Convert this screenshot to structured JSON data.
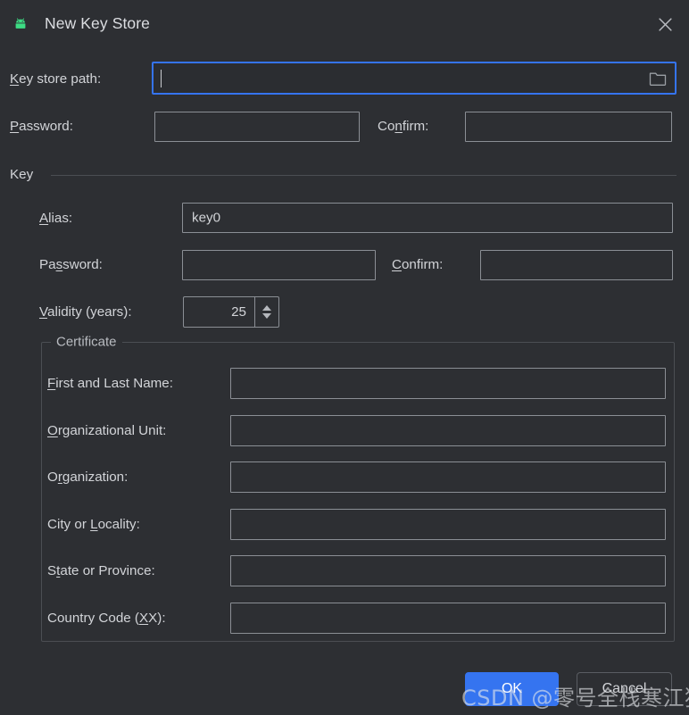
{
  "window": {
    "title": "New Key Store",
    "app_icon": "android-icon",
    "close_icon": "close-icon",
    "background_color": "#2d2f33",
    "accent_color": "#3574f0"
  },
  "keystore": {
    "path_label_pre": "K",
    "path_label_post": "ey store path:",
    "path_value": "",
    "browse_icon": "folder-icon",
    "password_label_pre": "P",
    "password_label_post": "assword:",
    "password_value": "",
    "confirm_label_pre": "Co",
    "confirm_label_mn": "n",
    "confirm_label_post": "firm:",
    "confirm_value": ""
  },
  "key_section": {
    "title": "Key",
    "alias_label_pre": "A",
    "alias_label_post": "lias:",
    "alias_value": "key0",
    "password_label_pre": "Pa",
    "password_label_mn": "s",
    "password_label_post": "sword:",
    "password_value": "",
    "confirm_label_pre": "C",
    "confirm_label_post": "onfirm:",
    "confirm_value": "",
    "validity_label_pre": "V",
    "validity_label_post": "alidity (years):",
    "validity_value": "25",
    "spinner_up_icon": "chevron-up-icon",
    "spinner_down_icon": "chevron-down-icon"
  },
  "certificate": {
    "legend": "Certificate",
    "fields": [
      {
        "pre": "F",
        "mn": "",
        "post": "irst and Last Name:",
        "value": "",
        "name": "first-and-last-name"
      },
      {
        "pre": "O",
        "mn": "",
        "post": "rganizational Unit:",
        "value": "",
        "name": "organizational-unit"
      },
      {
        "pre": "O",
        "mn": "r",
        "post": "ganization:",
        "value": "",
        "name": "organization"
      },
      {
        "pre": "City or ",
        "mn": "L",
        "post": "ocality:",
        "value": "",
        "name": "city-or-locality"
      },
      {
        "pre": "S",
        "mn": "t",
        "post": "ate or Province:",
        "value": "",
        "name": "state-or-province"
      },
      {
        "pre": "Country Code (",
        "mn": "X",
        "post": "X):",
        "value": "",
        "name": "country-code"
      }
    ]
  },
  "footer": {
    "ok_label": "OK",
    "cancel_label": "Cancel"
  },
  "watermark": {
    "text": "CSDN @零号全栈寒江独钓"
  }
}
